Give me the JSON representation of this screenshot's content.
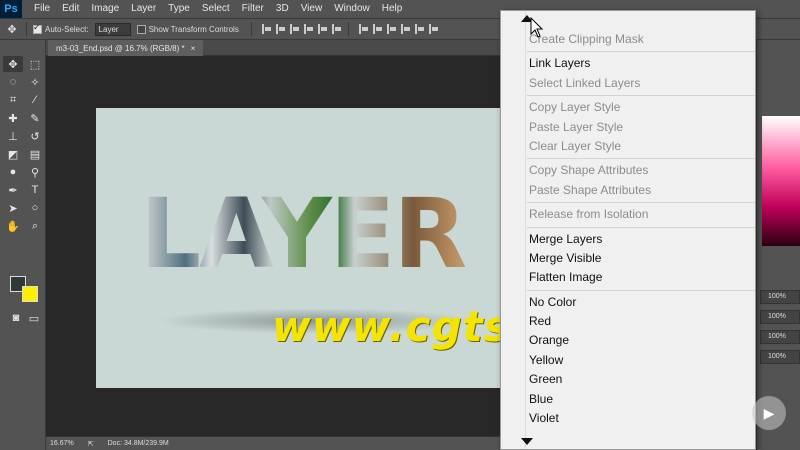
{
  "app": {
    "logo": "Ps"
  },
  "menubar": {
    "items": [
      "File",
      "Edit",
      "Image",
      "Layer",
      "Type",
      "Select",
      "Filter",
      "3D",
      "View",
      "Window",
      "Help"
    ]
  },
  "options": {
    "auto_select_label": "Auto-Select:",
    "auto_select_value": "Layer",
    "transform_label": "Show Transform Controls"
  },
  "document": {
    "tab_title": "m3-03_End.psd @ 16.7% (RGB/8) *",
    "close": "×",
    "artwork_text": "LAYER"
  },
  "statusbar": {
    "zoom": "16.67%",
    "doc": "Doc: 34.8M/239.9M"
  },
  "watermark": "www.cgtsj.com",
  "panels": {
    "percent1": "100%",
    "percent2": "100%",
    "percent3": "100%",
    "percent4": "100%"
  },
  "context_menu": {
    "groups": [
      [
        {
          "label": "Create Clipping Mask",
          "enabled": false
        }
      ],
      [
        {
          "label": "Link Layers",
          "enabled": true
        },
        {
          "label": "Select Linked Layers",
          "enabled": false
        }
      ],
      [
        {
          "label": "Copy Layer Style",
          "enabled": false
        },
        {
          "label": "Paste Layer Style",
          "enabled": false
        },
        {
          "label": "Clear Layer Style",
          "enabled": false
        }
      ],
      [
        {
          "label": "Copy Shape Attributes",
          "enabled": false
        },
        {
          "label": "Paste Shape Attributes",
          "enabled": false
        }
      ],
      [
        {
          "label": "Release from Isolation",
          "enabled": false
        }
      ],
      [
        {
          "label": "Merge Layers",
          "enabled": true
        },
        {
          "label": "Merge Visible",
          "enabled": true
        },
        {
          "label": "Flatten Image",
          "enabled": true
        }
      ],
      [
        {
          "label": "No Color",
          "enabled": true
        },
        {
          "label": "Red",
          "enabled": true
        },
        {
          "label": "Orange",
          "enabled": true
        },
        {
          "label": "Yellow",
          "enabled": true
        },
        {
          "label": "Green",
          "enabled": true
        },
        {
          "label": "Blue",
          "enabled": true
        },
        {
          "label": "Violet",
          "enabled": true
        }
      ]
    ]
  },
  "colors": {
    "foreground": "#2e3a3a",
    "background": "#ffef00",
    "canvas": "#c9d8d5",
    "watermark": "#f4e400"
  }
}
